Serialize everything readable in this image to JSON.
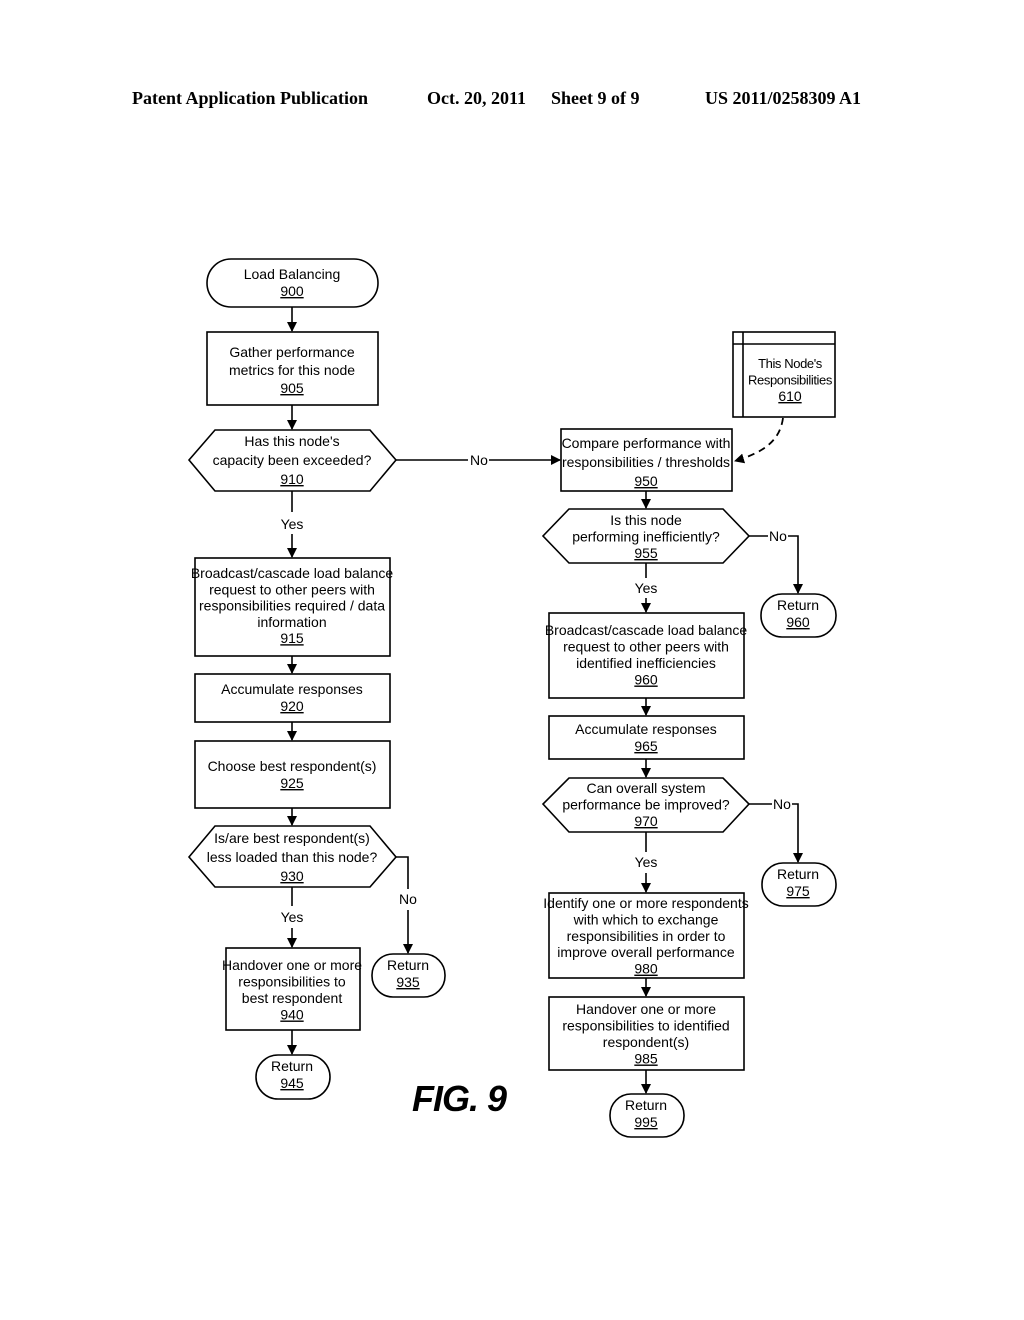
{
  "header": {
    "publication": "Patent Application Publication",
    "date": "Oct. 20, 2011",
    "sheet": "Sheet 9 of 9",
    "number": "US 2011/0258309 A1"
  },
  "figure_label": "FIG. 9",
  "nodes": {
    "n900": {
      "type": "terminator",
      "lines": [
        "Load Balancing"
      ],
      "ref": "900"
    },
    "n905": {
      "type": "process",
      "lines": [
        "Gather performance",
        "metrics for this node"
      ],
      "ref": "905"
    },
    "n910": {
      "type": "decision",
      "lines": [
        "Has this node's",
        "capacity been exceeded?"
      ],
      "ref": "910"
    },
    "n915": {
      "type": "process",
      "lines": [
        "Broadcast/cascade load balance",
        "request to other peers with",
        "responsibilities required / data",
        "information"
      ],
      "ref": "915"
    },
    "n920": {
      "type": "process",
      "lines": [
        "Accumulate responses"
      ],
      "ref": "920"
    },
    "n925": {
      "type": "process",
      "lines": [
        "Choose best respondent(s)"
      ],
      "ref": "925"
    },
    "n930": {
      "type": "decision",
      "lines": [
        "Is/are best respondent(s)",
        "less loaded than this node?"
      ],
      "ref": "930"
    },
    "n935": {
      "type": "terminator",
      "lines": [
        "Return"
      ],
      "ref": "935"
    },
    "n940": {
      "type": "process",
      "lines": [
        "Handover one or more",
        "responsibilities to",
        "best respondent"
      ],
      "ref": "940"
    },
    "n945": {
      "type": "terminator",
      "lines": [
        "Return"
      ],
      "ref": "945"
    },
    "n610": {
      "type": "datastore",
      "lines": [
        "This Node's",
        "Responsibilities"
      ],
      "ref": "610"
    },
    "n950": {
      "type": "process",
      "lines": [
        "Compare performance with",
        "responsibilities / thresholds"
      ],
      "ref": "950"
    },
    "n955": {
      "type": "decision",
      "lines": [
        "Is this node",
        "performing inefficiently?"
      ],
      "ref": "955"
    },
    "n960r": {
      "type": "terminator",
      "lines": [
        "Return"
      ],
      "ref": "960"
    },
    "n960": {
      "type": "process",
      "lines": [
        "Broadcast/cascade load balance",
        "request to other peers with",
        "identified inefficiencies"
      ],
      "ref": "960"
    },
    "n965": {
      "type": "process",
      "lines": [
        "Accumulate responses"
      ],
      "ref": "965"
    },
    "n970": {
      "type": "decision",
      "lines": [
        "Can overall system",
        "performance be improved?"
      ],
      "ref": "970"
    },
    "n975": {
      "type": "terminator",
      "lines": [
        "Return"
      ],
      "ref": "975"
    },
    "n980": {
      "type": "process",
      "lines": [
        "Identify one or more respondents",
        "with which to exchange",
        "responsibilities in order to",
        "improve overall performance"
      ],
      "ref": "980"
    },
    "n985": {
      "type": "process",
      "lines": [
        "Handover one or more",
        "responsibilities to identified",
        "respondent(s)"
      ],
      "ref": "985"
    },
    "n995": {
      "type": "terminator",
      "lines": [
        "Return"
      ],
      "ref": "995"
    }
  },
  "edge_labels": {
    "no_910": "No",
    "yes_910": "Yes",
    "yes_930": "Yes",
    "no_930": "No",
    "no_955": "No",
    "yes_955": "Yes",
    "no_970": "No",
    "yes_970": "Yes"
  }
}
